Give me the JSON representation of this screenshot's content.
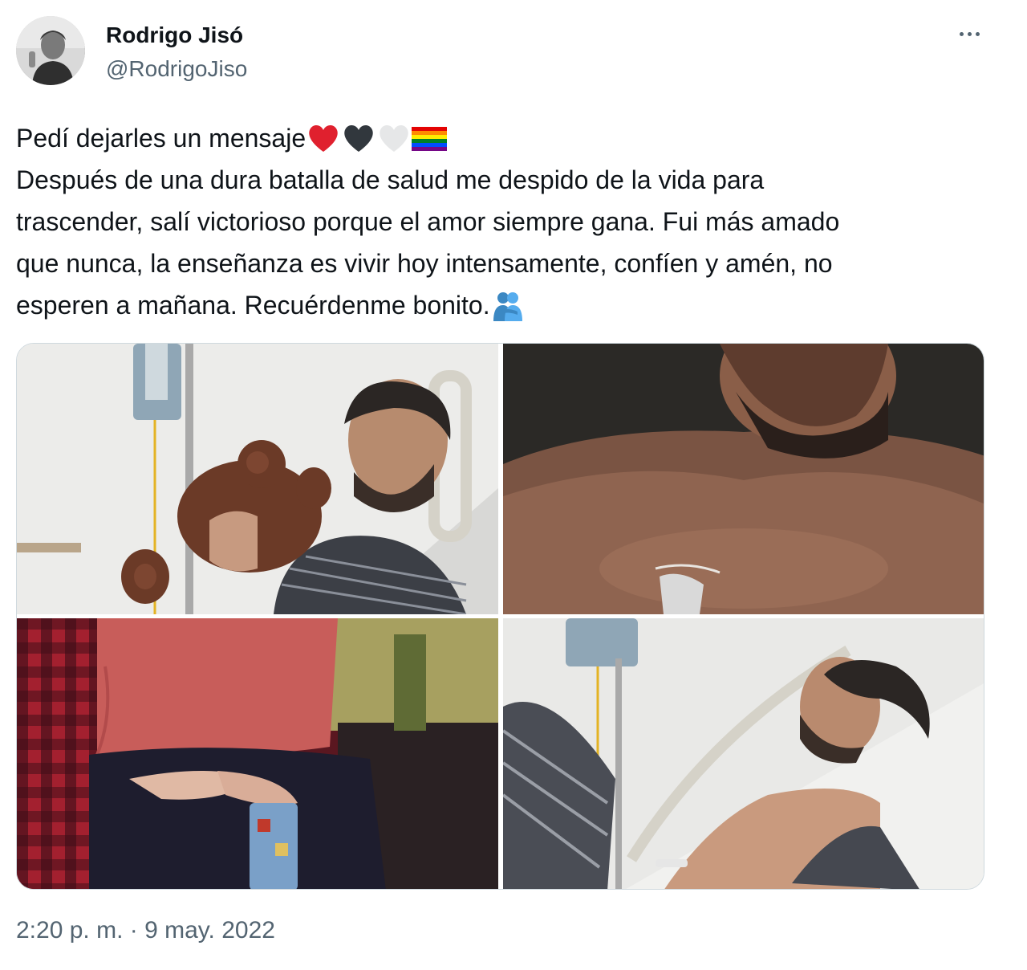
{
  "author": {
    "name": "Rodrigo Jisó",
    "handle": "@RodrigoJiso"
  },
  "tweet": {
    "lines": [
      "Pedí dejarles un mensaje",
      "Después de una dura batalla de salud me despido de la vida para",
      "trascender, salí victorioso porque el amor siempre gana. Fui más amado",
      "que nunca, la enseñanza es vivir hoy intensamente, confíen y amén, no",
      "esperen a mañana. Recuérdenme bonito."
    ],
    "line1_emojis": [
      "red-heart-emoji",
      "black-heart-emoji",
      "white-heart-emoji",
      "rainbow-flag-emoji"
    ],
    "line5_emojis": [
      "people-hugging-emoji"
    ]
  },
  "media": {
    "count": 4,
    "photos": [
      "photo-hospital-teddy-bear",
      "photo-chest-portrait",
      "photo-red-sweater-seated",
      "photo-hospital-bed"
    ]
  },
  "timestamp": "2:20 p. m. · 9 may. 2022",
  "colors": {
    "text": "#0f1419",
    "secondary": "#536471",
    "border": "#cfd9de",
    "heart_red": "#e0202e"
  }
}
